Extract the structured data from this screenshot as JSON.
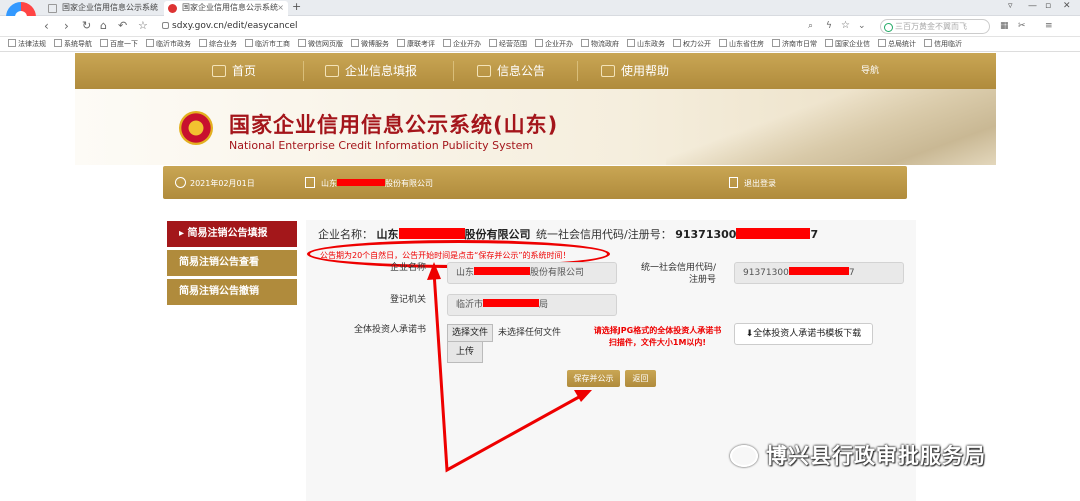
{
  "browser": {
    "tabs": [
      {
        "label": "国家企业信用信息公示系统"
      },
      {
        "label": "国家企业信用信息公示系统"
      }
    ],
    "url": "sdxy.gov.cn/edit/easycancel",
    "search_placeholder": "三百万黄金不翼而飞",
    "bookmarks": [
      "法律法规",
      "系统导航",
      "百度一下",
      "临沂市政务",
      "综合业务",
      "临沂市工商",
      "微信网页版",
      "微博服务",
      "康联考评",
      "企业开办",
      "经营范围",
      "企业开办",
      "物流政府",
      "山东政务",
      "权力公开",
      "山东省住房",
      "济南市日常",
      "国家企业信",
      "总局统计",
      "信用临沂"
    ]
  },
  "nav": {
    "items": [
      "首页",
      "企业信息填报",
      "信息公告",
      "使用帮助"
    ],
    "right": "导航"
  },
  "banner": {
    "title": "国家企业信用信息公示系统(山东)",
    "subtitle": "National Enterprise Credit Information Publicity System"
  },
  "infobar": {
    "date": "2021年02月01日",
    "company_prefix": "山东",
    "company_suffix": "股份有限公司",
    "logout": "退出登录"
  },
  "sidebar": {
    "items": [
      "简易注销公告填报",
      "简易注销公告查看",
      "简易注销公告撤销"
    ]
  },
  "form": {
    "header_name_label": "企业名称：",
    "header_name_prefix": "山东",
    "header_name_suffix": "股份有限公司",
    "header_code_label": "统一社会信用代码/注册号：",
    "header_code_prefix": "91371300",
    "header_code_suffix": "7",
    "notice": "公告期为20个自然日，公告开始时间是点击“保存并公示”的系统时间！",
    "company_label": "企业名称",
    "company_prefix": "山东",
    "company_suffix": "股份有限公司",
    "code_label": "统一社会信用代码/注册号",
    "code_prefix": "91371300",
    "code_suffix": "7",
    "authority_label": "登记机关",
    "authority_prefix": "临沂市",
    "authority_suffix": "局",
    "commit_label": "全体投资人承诺书",
    "choose_file": "选择文件",
    "no_file": "未选择任何文件",
    "upload": "上传",
    "hint": "请选择JPG格式的全体投资人承诺书扫描件，文件大小1M以内!",
    "download": "全体投资人承诺书模板下载",
    "save": "保存并公示",
    "back": "返回"
  },
  "watermark": "博兴县行政审批服务局",
  "colors": {
    "gold": "#b08b3c",
    "accent_red": "#a3171a",
    "annotation_red": "#ee0000"
  }
}
